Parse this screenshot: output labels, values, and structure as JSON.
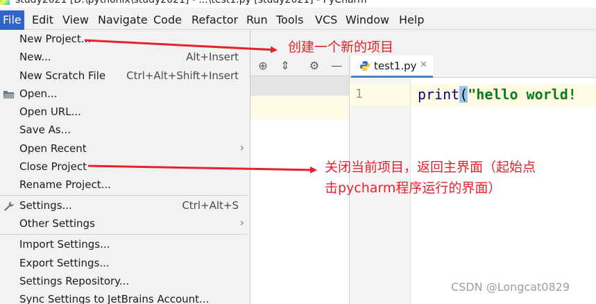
{
  "window": {
    "title": "study2021 [D:\\pythonix\\study2021] - ...\\test1.py [study2021] - PyCharm"
  },
  "menubar": {
    "items": [
      "File",
      "Edit",
      "View",
      "Navigate",
      "Code",
      "Refactor",
      "Run",
      "Tools",
      "VCS",
      "Window",
      "Help"
    ],
    "active": "File"
  },
  "file_menu": {
    "items": [
      {
        "label": "New Project...",
        "shortcut": ""
      },
      {
        "label": "New...",
        "shortcut": "Alt+Insert"
      },
      {
        "label": "New Scratch File",
        "shortcut": "Ctrl+Alt+Shift+Insert"
      },
      {
        "label": "Open...",
        "shortcut": "",
        "icon": "folder-icon"
      },
      {
        "label": "Open URL...",
        "shortcut": ""
      },
      {
        "label": "Save As...",
        "shortcut": ""
      },
      {
        "label": "Open Recent",
        "shortcut": "",
        "submenu": true
      },
      {
        "label": "Close Project",
        "shortcut": ""
      },
      {
        "label": "Rename Project...",
        "shortcut": ""
      },
      {
        "label": "Settings...",
        "shortcut": "Ctrl+Alt+S",
        "icon": "wrench-icon"
      },
      {
        "label": "Other Settings",
        "shortcut": "",
        "submenu": true
      },
      {
        "label": "Import Settings...",
        "shortcut": ""
      },
      {
        "label": "Export Settings...",
        "shortcut": ""
      },
      {
        "label": "Settings Repository...",
        "shortcut": ""
      },
      {
        "label": "Sync Settings to JetBrains Account...",
        "shortcut": ""
      }
    ]
  },
  "editor": {
    "tab_label": "test1.py",
    "line_number": "1",
    "code": {
      "fn": "print",
      "paren": "(",
      "str": "\"hello world!"
    }
  },
  "annotations": {
    "new_project": "创建一个新的项目",
    "close_project_line1": "关闭当前项目，返回主界面（起始点",
    "close_project_line2": "击pycharm程序运行的界面）"
  },
  "watermark": "CSDN @Longcat0829",
  "colors": {
    "menu_active": "#2f65ca",
    "annotation": "#e8202b",
    "code_fn": "#000080",
    "code_string": "#067d17"
  }
}
